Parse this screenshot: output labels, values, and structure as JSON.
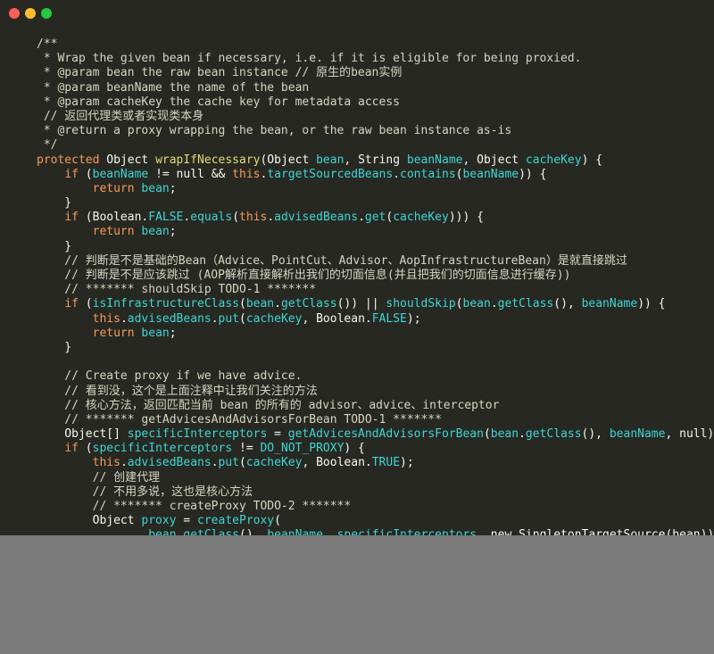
{
  "window": {
    "controls": [
      "close",
      "minimize",
      "zoom"
    ],
    "colors": {
      "close": "#ff5f56",
      "minimize": "#ffbd2e",
      "zoom": "#27c93f",
      "background": "#272822"
    }
  },
  "code": {
    "lines": [
      [
        {
          "t": "/**",
          "c": "comment"
        }
      ],
      [
        {
          "t": " * Wrap the given bean if necessary, i.e. if it is eligible for being proxied.",
          "c": "comment"
        }
      ],
      [
        {
          "t": " * @param bean the raw bean instance // 原生的bean实例",
          "c": "comment"
        }
      ],
      [
        {
          "t": " * @param beanName the name of the bean",
          "c": "comment"
        }
      ],
      [
        {
          "t": " * @param cacheKey the cache key for metadata access",
          "c": "comment"
        }
      ],
      [
        {
          "t": " // 返回代理类或者实现类本身",
          "c": "comment"
        }
      ],
      [
        {
          "t": " * @return a proxy wrapping the bean, or the raw bean instance as-is",
          "c": "comment"
        }
      ],
      [
        {
          "t": " */",
          "c": "comment"
        }
      ],
      [
        {
          "t": "protected",
          "c": "kw"
        },
        {
          "t": " Object ",
          "c": "plain"
        },
        {
          "t": "wrapIfNecessary",
          "c": "fn"
        },
        {
          "t": "(Object ",
          "c": "plain"
        },
        {
          "t": "bean",
          "c": "var"
        },
        {
          "t": ", String ",
          "c": "plain"
        },
        {
          "t": "beanName",
          "c": "var"
        },
        {
          "t": ", Object ",
          "c": "plain"
        },
        {
          "t": "cacheKey",
          "c": "var"
        },
        {
          "t": ") {",
          "c": "plain"
        }
      ],
      [
        {
          "t": "    ",
          "c": "plain"
        },
        {
          "t": "if",
          "c": "kw"
        },
        {
          "t": " (",
          "c": "plain"
        },
        {
          "t": "beanName",
          "c": "var"
        },
        {
          "t": " != null && ",
          "c": "plain"
        },
        {
          "t": "this",
          "c": "kw"
        },
        {
          "t": ".",
          "c": "plain"
        },
        {
          "t": "targetSourcedBeans",
          "c": "var"
        },
        {
          "t": ".",
          "c": "plain"
        },
        {
          "t": "contains",
          "c": "var"
        },
        {
          "t": "(",
          "c": "plain"
        },
        {
          "t": "beanName",
          "c": "var"
        },
        {
          "t": ")) {",
          "c": "plain"
        }
      ],
      [
        {
          "t": "        ",
          "c": "plain"
        },
        {
          "t": "return",
          "c": "kw"
        },
        {
          "t": " ",
          "c": "plain"
        },
        {
          "t": "bean",
          "c": "var"
        },
        {
          "t": ";",
          "c": "plain"
        }
      ],
      [
        {
          "t": "    }",
          "c": "plain"
        }
      ],
      [
        {
          "t": "    ",
          "c": "plain"
        },
        {
          "t": "if",
          "c": "kw"
        },
        {
          "t": " (Boolean.",
          "c": "plain"
        },
        {
          "t": "FALSE",
          "c": "const"
        },
        {
          "t": ".",
          "c": "plain"
        },
        {
          "t": "equals",
          "c": "var"
        },
        {
          "t": "(",
          "c": "plain"
        },
        {
          "t": "this",
          "c": "kw"
        },
        {
          "t": ".",
          "c": "plain"
        },
        {
          "t": "advisedBeans",
          "c": "var"
        },
        {
          "t": ".",
          "c": "plain"
        },
        {
          "t": "get",
          "c": "var"
        },
        {
          "t": "(",
          "c": "plain"
        },
        {
          "t": "cacheKey",
          "c": "var"
        },
        {
          "t": "))) {",
          "c": "plain"
        }
      ],
      [
        {
          "t": "        ",
          "c": "plain"
        },
        {
          "t": "return",
          "c": "kw"
        },
        {
          "t": " ",
          "c": "plain"
        },
        {
          "t": "bean",
          "c": "var"
        },
        {
          "t": ";",
          "c": "plain"
        }
      ],
      [
        {
          "t": "    }",
          "c": "plain"
        }
      ],
      [
        {
          "t": "    // 判断是不是基础的Bean（Advice、PointCut、Advisor、AopInfrastructureBean）是就直接跳过",
          "c": "comment"
        }
      ],
      [
        {
          "t": "    // 判断是不是应该跳过 (AOP解析直接解析出我们的切面信息(并且把我们的切面信息进行缓存))",
          "c": "comment"
        }
      ],
      [
        {
          "t": "    // ******* shouldSkip TODO-1 *******",
          "c": "comment"
        }
      ],
      [
        {
          "t": "    ",
          "c": "plain"
        },
        {
          "t": "if",
          "c": "kw"
        },
        {
          "t": " (",
          "c": "plain"
        },
        {
          "t": "isInfrastructureClass",
          "c": "var"
        },
        {
          "t": "(",
          "c": "plain"
        },
        {
          "t": "bean",
          "c": "var"
        },
        {
          "t": ".",
          "c": "plain"
        },
        {
          "t": "getClass",
          "c": "var"
        },
        {
          "t": "()) || ",
          "c": "plain"
        },
        {
          "t": "shouldSkip",
          "c": "var"
        },
        {
          "t": "(",
          "c": "plain"
        },
        {
          "t": "bean",
          "c": "var"
        },
        {
          "t": ".",
          "c": "plain"
        },
        {
          "t": "getClass",
          "c": "var"
        },
        {
          "t": "(), ",
          "c": "plain"
        },
        {
          "t": "beanName",
          "c": "var"
        },
        {
          "t": ")) {",
          "c": "plain"
        }
      ],
      [
        {
          "t": "        ",
          "c": "plain"
        },
        {
          "t": "this",
          "c": "kw"
        },
        {
          "t": ".",
          "c": "plain"
        },
        {
          "t": "advisedBeans",
          "c": "var"
        },
        {
          "t": ".",
          "c": "plain"
        },
        {
          "t": "put",
          "c": "var"
        },
        {
          "t": "(",
          "c": "plain"
        },
        {
          "t": "cacheKey",
          "c": "var"
        },
        {
          "t": ", Boolean.",
          "c": "plain"
        },
        {
          "t": "FALSE",
          "c": "const"
        },
        {
          "t": ");",
          "c": "plain"
        }
      ],
      [
        {
          "t": "        ",
          "c": "plain"
        },
        {
          "t": "return",
          "c": "kw"
        },
        {
          "t": " ",
          "c": "plain"
        },
        {
          "t": "bean",
          "c": "var"
        },
        {
          "t": ";",
          "c": "plain"
        }
      ],
      [
        {
          "t": "    }",
          "c": "plain"
        }
      ],
      [
        {
          "t": "",
          "c": "plain"
        }
      ],
      [
        {
          "t": "    // Create proxy if we have advice.",
          "c": "comment"
        }
      ],
      [
        {
          "t": "    // 看到没，这个是上面注释中让我们关注的方法",
          "c": "comment"
        }
      ],
      [
        {
          "t": "    // 核心方法，返回匹配当前 bean 的所有的 advisor、advice、interceptor",
          "c": "comment"
        }
      ],
      [
        {
          "t": "    // ******* getAdvicesAndAdvisorsForBean TODO-1 *******",
          "c": "comment"
        }
      ],
      [
        {
          "t": "    Object[] ",
          "c": "plain"
        },
        {
          "t": "specificInterceptors",
          "c": "var"
        },
        {
          "t": " = ",
          "c": "plain"
        },
        {
          "t": "getAdvicesAndAdvisorsForBean",
          "c": "var"
        },
        {
          "t": "(",
          "c": "plain"
        },
        {
          "t": "bean",
          "c": "var"
        },
        {
          "t": ".",
          "c": "plain"
        },
        {
          "t": "getClass",
          "c": "var"
        },
        {
          "t": "(), ",
          "c": "plain"
        },
        {
          "t": "beanName",
          "c": "var"
        },
        {
          "t": ", null);",
          "c": "plain"
        }
      ],
      [
        {
          "t": "    ",
          "c": "plain"
        },
        {
          "t": "if",
          "c": "kw"
        },
        {
          "t": " (",
          "c": "plain"
        },
        {
          "t": "specificInterceptors",
          "c": "var"
        },
        {
          "t": " != ",
          "c": "plain"
        },
        {
          "t": "DO_NOT_PROXY",
          "c": "const"
        },
        {
          "t": ") {",
          "c": "plain"
        }
      ],
      [
        {
          "t": "        ",
          "c": "plain"
        },
        {
          "t": "this",
          "c": "kw"
        },
        {
          "t": ".",
          "c": "plain"
        },
        {
          "t": "advisedBeans",
          "c": "var"
        },
        {
          "t": ".",
          "c": "plain"
        },
        {
          "t": "put",
          "c": "var"
        },
        {
          "t": "(",
          "c": "plain"
        },
        {
          "t": "cacheKey",
          "c": "var"
        },
        {
          "t": ", Boolean.",
          "c": "plain"
        },
        {
          "t": "TRUE",
          "c": "const"
        },
        {
          "t": ");",
          "c": "plain"
        }
      ],
      [
        {
          "t": "        // 创建代理",
          "c": "comment"
        }
      ],
      [
        {
          "t": "        // 不用多说，这也是核心方法",
          "c": "comment"
        }
      ],
      [
        {
          "t": "        // ******* createProxy TODO-2 *******",
          "c": "comment"
        }
      ],
      [
        {
          "t": "        Object ",
          "c": "plain"
        },
        {
          "t": "proxy",
          "c": "var"
        },
        {
          "t": " = ",
          "c": "plain"
        },
        {
          "t": "createProxy",
          "c": "var"
        },
        {
          "t": "(",
          "c": "plain"
        }
      ],
      [
        {
          "t": "                ",
          "c": "plain"
        },
        {
          "t": "bean",
          "c": "var"
        },
        {
          "t": ".",
          "c": "plain"
        },
        {
          "t": "getClass",
          "c": "var"
        },
        {
          "t": "(), ",
          "c": "plain"
        },
        {
          "t": "beanName",
          "c": "var"
        },
        {
          "t": ", ",
          "c": "plain"
        },
        {
          "t": "specificInterceptors",
          "c": "var"
        },
        {
          "t": ", new SingletonTargetSource(bean));",
          "c": "plain"
        }
      ]
    ]
  }
}
